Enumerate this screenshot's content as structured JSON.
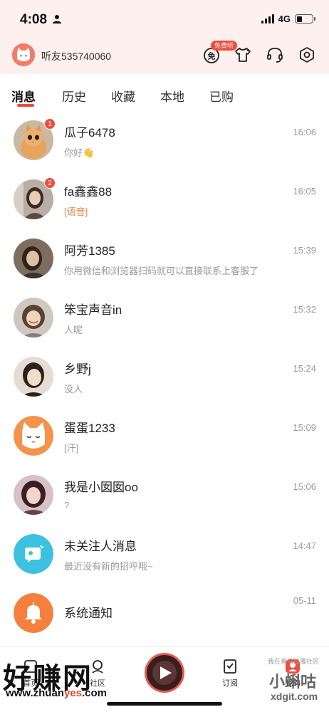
{
  "status": {
    "time": "4:08",
    "network": "4G",
    "battery_level": 0.35
  },
  "header": {
    "username": "听友535740060",
    "free_badge": "免费听",
    "free_icon_char": "免"
  },
  "tabs": [
    {
      "label": "消息",
      "active": true
    },
    {
      "label": "历史"
    },
    {
      "label": "收藏"
    },
    {
      "label": "本地"
    },
    {
      "label": "已购"
    }
  ],
  "messages": [
    {
      "name": "瓜子6478",
      "preview": "你好👋",
      "time": "16:06",
      "badge": "1",
      "avatar_color": "#e7a35c"
    },
    {
      "name": "fa鑫鑫88",
      "preview": "[语音]",
      "time": "16:05",
      "badge": "2",
      "avatar_color": "#8a7d72"
    },
    {
      "name": "阿芳1385",
      "preview": "你用微信和浏览器扫码就可以直接联系上客服了",
      "time": "15:39",
      "badge": "",
      "avatar_color": "#6b5a4d"
    },
    {
      "name": "笨宝声音in",
      "preview": "人呢",
      "time": "15:32",
      "badge": "",
      "avatar_color": "#a49a8f"
    },
    {
      "name": "乡野j",
      "preview": "没人",
      "time": "15:24",
      "badge": "",
      "avatar_color": "#c8b7ab"
    },
    {
      "name": "蛋蛋1233",
      "preview": "[汗]",
      "time": "15:09",
      "badge": "",
      "avatar_color": "#f4934a"
    },
    {
      "name": "我是小囡囡oo",
      "preview": "?",
      "time": "15:06",
      "badge": "",
      "avatar_color": "#b48f86"
    },
    {
      "name": "未关注人消息",
      "preview": "最近没有新的招呼哦~",
      "time": "14:47",
      "badge": "",
      "avatar_color": "#3cc2e0"
    },
    {
      "name": "系统通知",
      "preview": "",
      "time": "05-11",
      "badge": "",
      "avatar_color": "#f5803e"
    }
  ],
  "bottom_nav": {
    "tab1_label": "首页",
    "tab2_label": "社区",
    "tab4_label": "订阅",
    "tab5_label": "我的"
  },
  "watermark": {
    "main": "好赚网",
    "url_a": "www.zhuan",
    "url_b": "yes",
    "url_c": ".com",
    "right_main": "小蝌咕",
    "right_url": "xdgit.com",
    "right_small": "我在喜马拉雅社区"
  }
}
